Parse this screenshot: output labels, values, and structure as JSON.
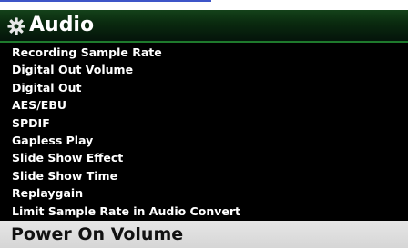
{
  "header": {
    "icon": "gear-icon",
    "title": "Audio"
  },
  "menu": {
    "items": [
      {
        "label": "Recording Sample Rate"
      },
      {
        "label": "Digital Out Volume"
      },
      {
        "label": "Digital Out"
      },
      {
        "label": "AES/EBU"
      },
      {
        "label": "SPDIF"
      },
      {
        "label": "Gapless Play"
      },
      {
        "label": "Slide Show Effect"
      },
      {
        "label": "Slide Show Time"
      },
      {
        "label": "Replaygain"
      },
      {
        "label": "Limit Sample Rate in Audio Convert"
      }
    ],
    "selected": {
      "label": "Power On Volume"
    }
  },
  "colors": {
    "header_green": "#14421a",
    "accent_green": "#1e7a2c",
    "background": "#000000",
    "text": "#ffffff",
    "selected_bg": "#e0e0e0",
    "top_line_blue": "#3d55c8"
  }
}
